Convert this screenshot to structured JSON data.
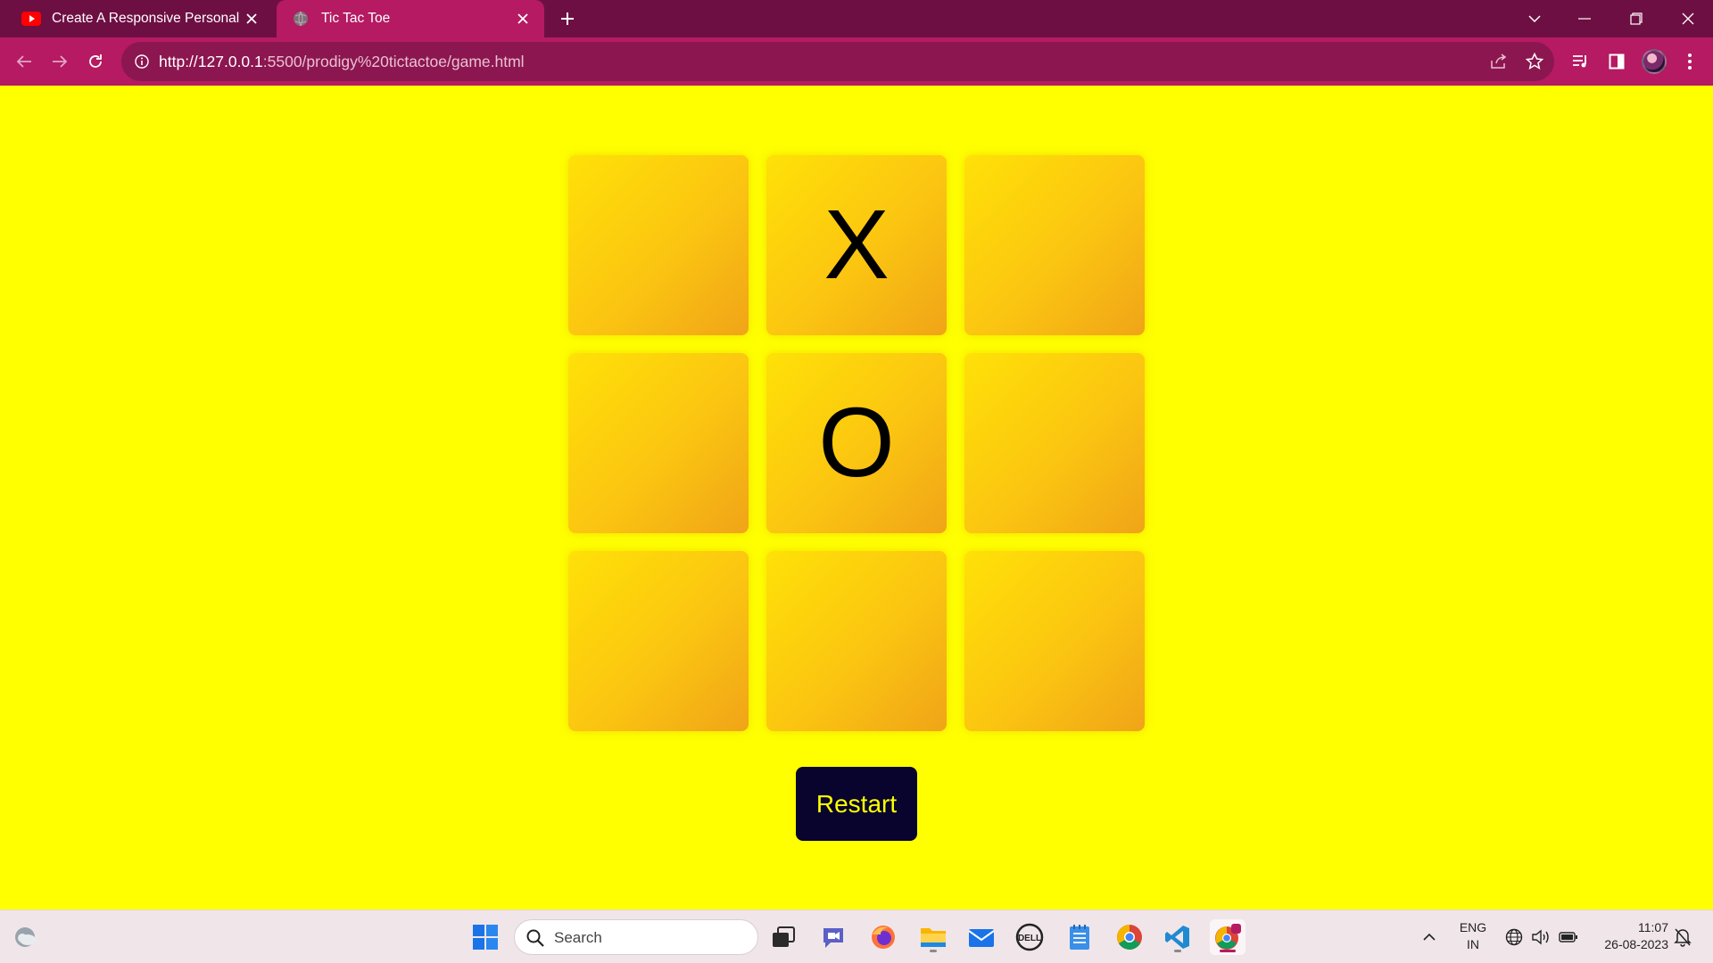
{
  "browser": {
    "tabs": [
      {
        "title": "Create A Responsive Personal PO",
        "icon": "youtube-icon",
        "active": false
      },
      {
        "title": "Tic Tac Toe",
        "icon": "globe-icon",
        "active": true
      }
    ],
    "url_host": "http://127.0.0.1",
    "url_rest": ":5500/prodigy%20tictactoe/game.html",
    "colors": {
      "tabstrip": "#6e0f43",
      "toolbar": "#b51a62",
      "omnibox": "#8c1650"
    }
  },
  "game": {
    "cells": [
      "",
      "X",
      "",
      "",
      "O",
      "",
      "",
      "",
      ""
    ],
    "restart_label": "Restart",
    "colors": {
      "background": "#ffff00",
      "cell_start": "#ffe107",
      "cell_end": "#f0a418",
      "button_bg": "#09042e",
      "button_text": "#ffff00"
    }
  },
  "taskbar": {
    "search_placeholder": "Search",
    "language_line1": "ENG",
    "language_line2": "IN",
    "time": "11:07",
    "date": "26-08-2023",
    "apps": [
      "windows-start-icon",
      "search-icon",
      "task-view-icon",
      "chat-icon",
      "firefox-icon",
      "file-explorer-icon",
      "mail-icon",
      "dell-icon",
      "notepad-icon",
      "chrome-icon",
      "vscode-icon",
      "chrome-canary-icon"
    ]
  }
}
